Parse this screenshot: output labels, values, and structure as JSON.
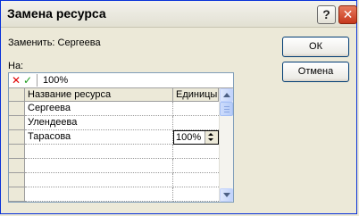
{
  "window": {
    "title": "Замена ресурса",
    "help_label": "?",
    "close_label": "✕"
  },
  "replace_label": "Заменить: Сергеева",
  "on_label": "На:",
  "buttons": {
    "ok": "ОК",
    "cancel": "Отмена"
  },
  "edit_bar": {
    "value": "100%",
    "cancel_icon": "x-icon",
    "accept_icon": "check-icon"
  },
  "table": {
    "columns": [
      "Название ресурса",
      "Единицы"
    ],
    "rows": [
      {
        "name": "Сергеева",
        "units": ""
      },
      {
        "name": "Улендеева",
        "units": ""
      },
      {
        "name": "Тарасова",
        "units": "100%"
      },
      {
        "name": "",
        "units": ""
      },
      {
        "name": "",
        "units": ""
      },
      {
        "name": "",
        "units": ""
      },
      {
        "name": "",
        "units": ""
      }
    ],
    "selected_row": 2
  },
  "colors": {
    "titlebar_border": "#0831d9",
    "dialog_bg": "#ece9d8",
    "cancel_mark": "#e00000",
    "accept_mark": "#1a9a1a"
  }
}
